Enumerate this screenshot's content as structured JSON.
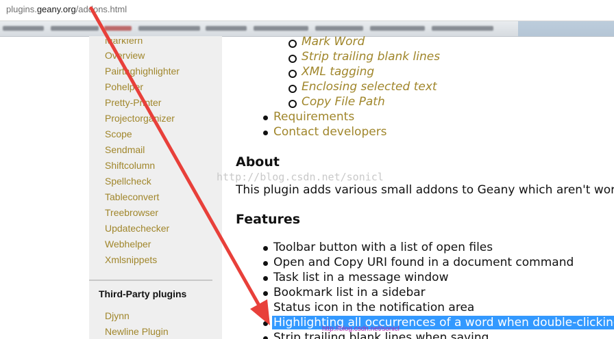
{
  "browser": {
    "url_domain": "plugins.geany.org",
    "url_path": "/addons.html"
  },
  "sidebar": {
    "items": [
      "Markfern",
      "Overview",
      "Pairtaghighlighter",
      "Pohelper",
      "Pretty-Printer",
      "Projectorganizer",
      "Scope",
      "Sendmail",
      "Shiftcolumn",
      "Spellcheck",
      "Tableconvert",
      "Treebrowser",
      "Updatechecker",
      "Webhelper",
      "Xmlsnippets"
    ],
    "third_party_heading": "Third-Party plugins",
    "third_party_items": [
      "Djynn",
      "Newline Plugin"
    ]
  },
  "main": {
    "toc_subitems": [
      "Mark Word",
      "Strip trailing blank lines",
      "XML tagging",
      "Enclosing selected text",
      "Copy File Path"
    ],
    "toc_items": [
      "Requirements",
      "Contact developers"
    ],
    "about_heading": "About",
    "about_text": "This plugin adds various small addons to Geany which aren't worth an o",
    "features_heading": "Features",
    "features": [
      "Toolbar button with a list of open files",
      "Open and Copy URI found in a document command",
      "Task list in a message window",
      "Bookmark list in a sidebar",
      "Status icon in the notification area",
      "Highlighting all occurrences of a word when double-clicking it",
      "Strip trailing blank lines when saving"
    ]
  },
  "overlay": {
    "watermark": "http://blog.csdn.net/sonicl",
    "watermark_small": "http://blog.csdn.net/sonicl"
  },
  "colors": {
    "link": "#a0862b",
    "selection": "#3399ff",
    "arrow": "#e8403a"
  }
}
